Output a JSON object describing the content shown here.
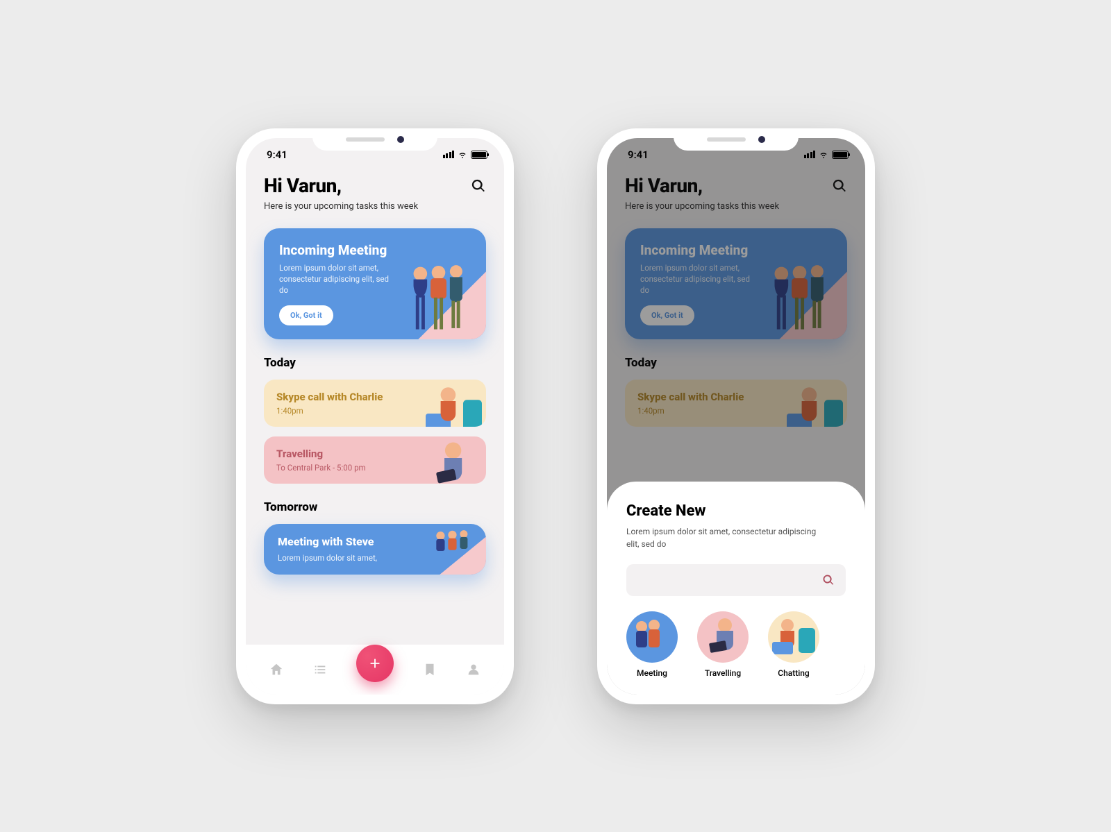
{
  "statusbar": {
    "time": "9:41"
  },
  "header": {
    "greeting": "Hi Varun,",
    "subtitle": "Here is your upcoming tasks this week"
  },
  "hero_card": {
    "title": "Incoming Meeting",
    "desc": "Lorem ipsum dolor sit amet, consectetur adipiscing elit, sed do",
    "button_label": "Ok, Got it"
  },
  "sections": {
    "today_label": "Today",
    "tomorrow_label": "Tomorrow"
  },
  "today_items": [
    {
      "title": "Skype call with Charlie",
      "time": "1:40pm"
    },
    {
      "title": "Travelling",
      "time": "To Central Park - 5:00 pm"
    }
  ],
  "tomorrow_items": [
    {
      "title": "Meeting with Steve",
      "desc": "Lorem ipsum dolor sit amet,"
    }
  ],
  "sheet": {
    "title": "Create New",
    "desc": "Lorem ipsum dolor sit amet, consectetur adipiscing elit, sed do",
    "categories": [
      {
        "label": "Meeting",
        "bg": "#5b96e0"
      },
      {
        "label": "Travelling",
        "bg": "#f4c2c5"
      },
      {
        "label": "Chatting",
        "bg": "#f9e7c3"
      }
    ]
  },
  "colors": {
    "accent_pink": "#e53665",
    "card_blue": "#5b96e0",
    "row_yellow": "#f9e7c3",
    "row_pink": "#f4c2c5"
  }
}
